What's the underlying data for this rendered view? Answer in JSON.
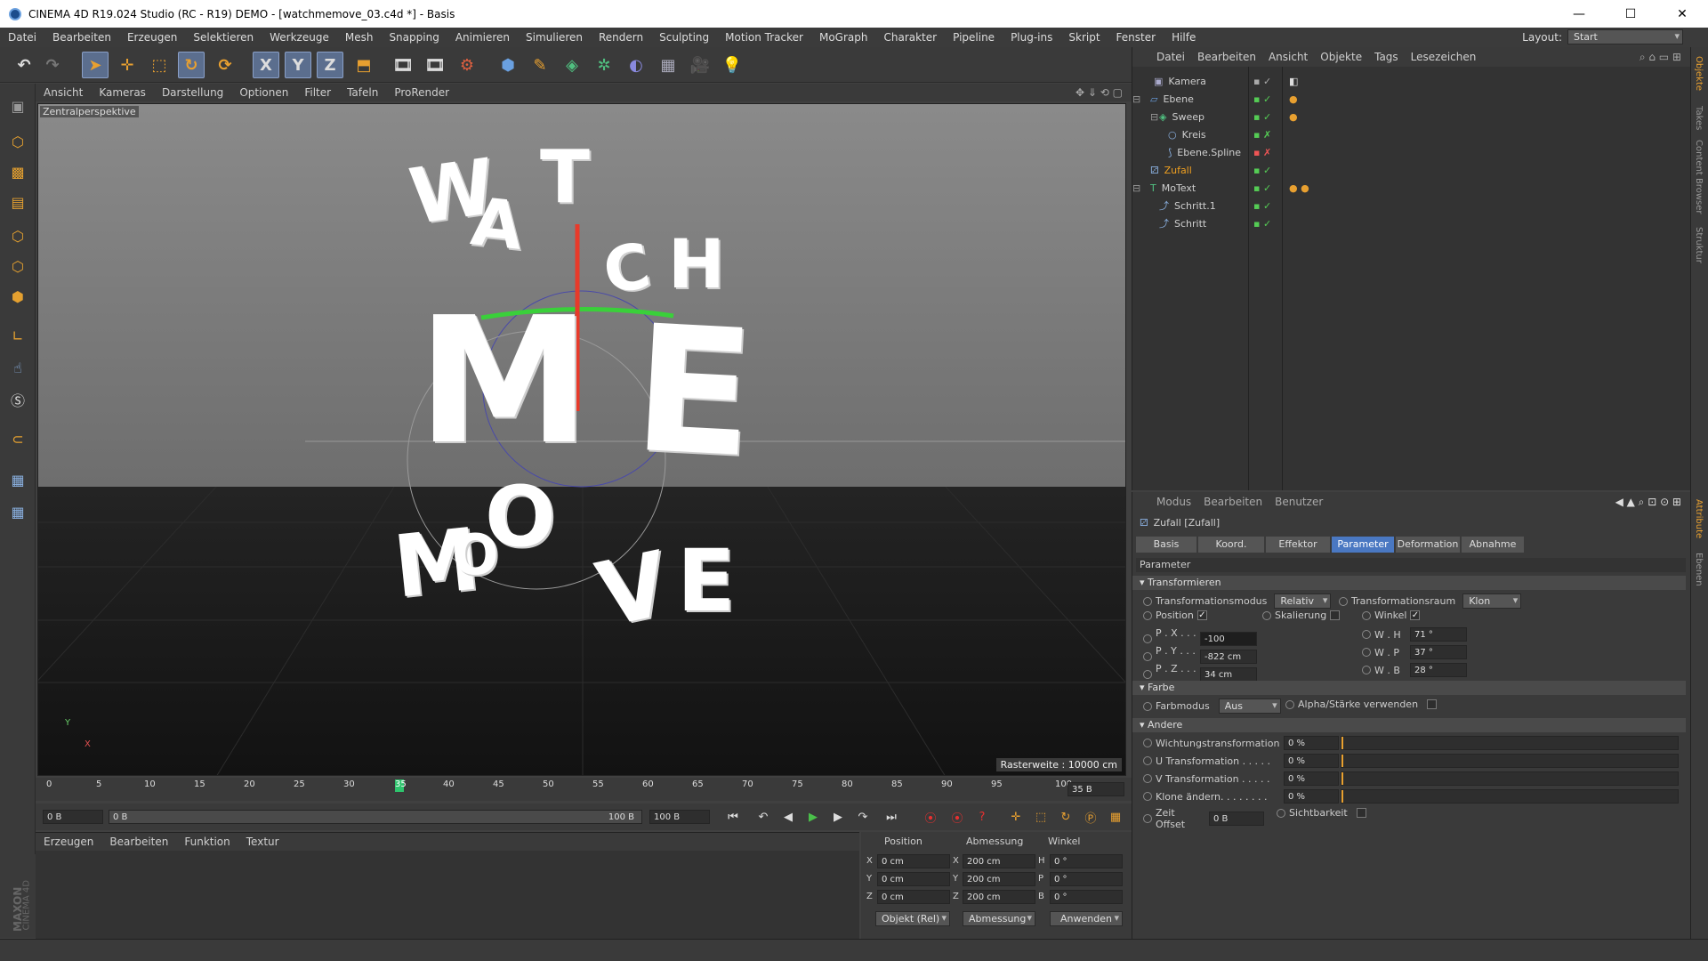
{
  "window": {
    "title": "CINEMA 4D R19.024 Studio (RC - R19) DEMO - [watchmemove_03.c4d *] - Basis",
    "min": "—",
    "max": "☐",
    "close": "✕"
  },
  "menu": [
    "Datei",
    "Bearbeiten",
    "Erzeugen",
    "Selektieren",
    "Werkzeuge",
    "Mesh",
    "Snapping",
    "Animieren",
    "Simulieren",
    "Rendern",
    "Sculpting",
    "Motion Tracker",
    "MoGraph",
    "Charakter",
    "Pipeline",
    "Plug-ins",
    "Skript",
    "Fenster",
    "Hilfe"
  ],
  "layout": {
    "label": "Layout:",
    "value": "Start"
  },
  "toolbar": {
    "x": "X",
    "y": "Y",
    "z": "Z"
  },
  "viewport": {
    "menu": [
      "Ansicht",
      "Kameras",
      "Darstellung",
      "Optionen",
      "Filter",
      "Tafeln",
      "ProRender"
    ],
    "label": "Zentralperspektive",
    "raster": "Rasterweite : 10000 cm",
    "letters": {
      "w": "W",
      "a": "A",
      "t": "T",
      "c": "C",
      "h": "H",
      "m": "M",
      "e": "E",
      "o": "O",
      "m2": "M",
      "o2": "O",
      "v": "V",
      "e2": "E"
    },
    "axis_y": "Y",
    "axis_x": "X"
  },
  "timeline": {
    "ticks": [
      "0",
      "5",
      "10",
      "15",
      "20",
      "25",
      "30",
      "35",
      "40",
      "45",
      "50",
      "55",
      "60",
      "65",
      "70",
      "75",
      "80",
      "85",
      "90",
      "95",
      "100"
    ],
    "current": "35",
    "end_field": "35 B",
    "start": "0 B",
    "range_start": "0 B",
    "range_end": "100 B",
    "max": "100 B"
  },
  "material": {
    "menu": [
      "Erzeugen",
      "Bearbeiten",
      "Funktion",
      "Textur"
    ],
    "brand1": "MAXON",
    "brand2": "CINEMA 4D"
  },
  "coords": {
    "headers": [
      "Position",
      "Abmessung",
      "Winkel"
    ],
    "rows": [
      {
        "a": "X",
        "pos": "0 cm",
        "b": "X",
        "size": "200 cm",
        "c": "H",
        "rot": "0 °"
      },
      {
        "a": "Y",
        "pos": "0 cm",
        "b": "Y",
        "size": "200 cm",
        "c": "P",
        "rot": "0 °"
      },
      {
        "a": "Z",
        "pos": "0 cm",
        "b": "Z",
        "size": "200 cm",
        "c": "B",
        "rot": "0 °"
      }
    ],
    "mode": "Objekt (Rel)",
    "size_mode": "Abmessung",
    "apply": "Anwenden"
  },
  "objects": {
    "menu": [
      "Datei",
      "Bearbeiten",
      "Ansicht",
      "Objekte",
      "Tags",
      "Lesezeichen"
    ],
    "items": [
      {
        "name": "Kamera",
        "color": "#cfcfcf",
        "icon": "camera-icon"
      },
      {
        "name": "Ebene",
        "color": "#cfcfcf",
        "icon": "plane-icon"
      },
      {
        "name": "Sweep",
        "color": "#cfcfcf",
        "icon": "sweep-icon"
      },
      {
        "name": "Kreis",
        "color": "#cfcfcf",
        "icon": "circle-spline-icon"
      },
      {
        "name": "Ebene.Spline",
        "color": "#cfcfcf",
        "icon": "spline-icon"
      },
      {
        "name": "Zufall",
        "color": "#f0a020",
        "icon": "random-effector-icon"
      },
      {
        "name": "MoText",
        "color": "#cfcfcf",
        "icon": "motext-icon"
      },
      {
        "name": "Schritt.1",
        "color": "#cfcfcf",
        "icon": "step-effector-icon"
      },
      {
        "name": "Schritt",
        "color": "#cfcfcf",
        "icon": "step-effector-icon"
      }
    ]
  },
  "attributes": {
    "menu": [
      "Modus",
      "Bearbeiten",
      "Benutzer"
    ],
    "object": "Zufall [Zufall]",
    "tabs": [
      "Basis",
      "Koord.",
      "Effektor",
      "Parameter",
      "Deformation",
      "Abnahme"
    ],
    "active_tab": "Parameter",
    "section_title": "Parameter",
    "transform": {
      "title": "Transformieren",
      "mode_label": "Transformationsmodus",
      "mode_value": "Relativ",
      "space_label": "Transformationsraum",
      "space_value": "Klon",
      "position": "Position",
      "scale": "Skalierung",
      "angle": "Winkel",
      "px_label": "P . X . . . .",
      "px": "-100",
      "py_label": "P . Y . . . .",
      "py": "-822 cm",
      "pz_label": "P . Z . . . .",
      "pz": "34 cm",
      "wh_label": "W . H",
      "wh": "71 °",
      "wp_label": "W . P",
      "wp": "37 °",
      "wb_label": "W . B",
      "wb": "28 °"
    },
    "color": {
      "title": "Farbe",
      "mode_label": "Farbmodus",
      "mode_value": "Aus",
      "alpha": "Alpha/Stärke verwenden"
    },
    "other": {
      "title": "Andere",
      "rows": [
        {
          "label": "Wichtungstransformation",
          "value": "0 %"
        },
        {
          "label": "U Transformation . . . . .",
          "value": "0 %"
        },
        {
          "label": "V Transformation . . . . .",
          "value": "0 %"
        },
        {
          "label": "Klone ändern. . . . . . . .",
          "value": "0 %"
        }
      ],
      "time_offset_label": "Zeit Offset",
      "time_offset": "0 B",
      "visibility": "Sichtbarkeit"
    }
  },
  "side_tabs": [
    "Objekte",
    "Takes",
    "Content Browser",
    "Struktur"
  ],
  "side_tabs_lower": [
    "Attribute",
    "Ebenen"
  ]
}
